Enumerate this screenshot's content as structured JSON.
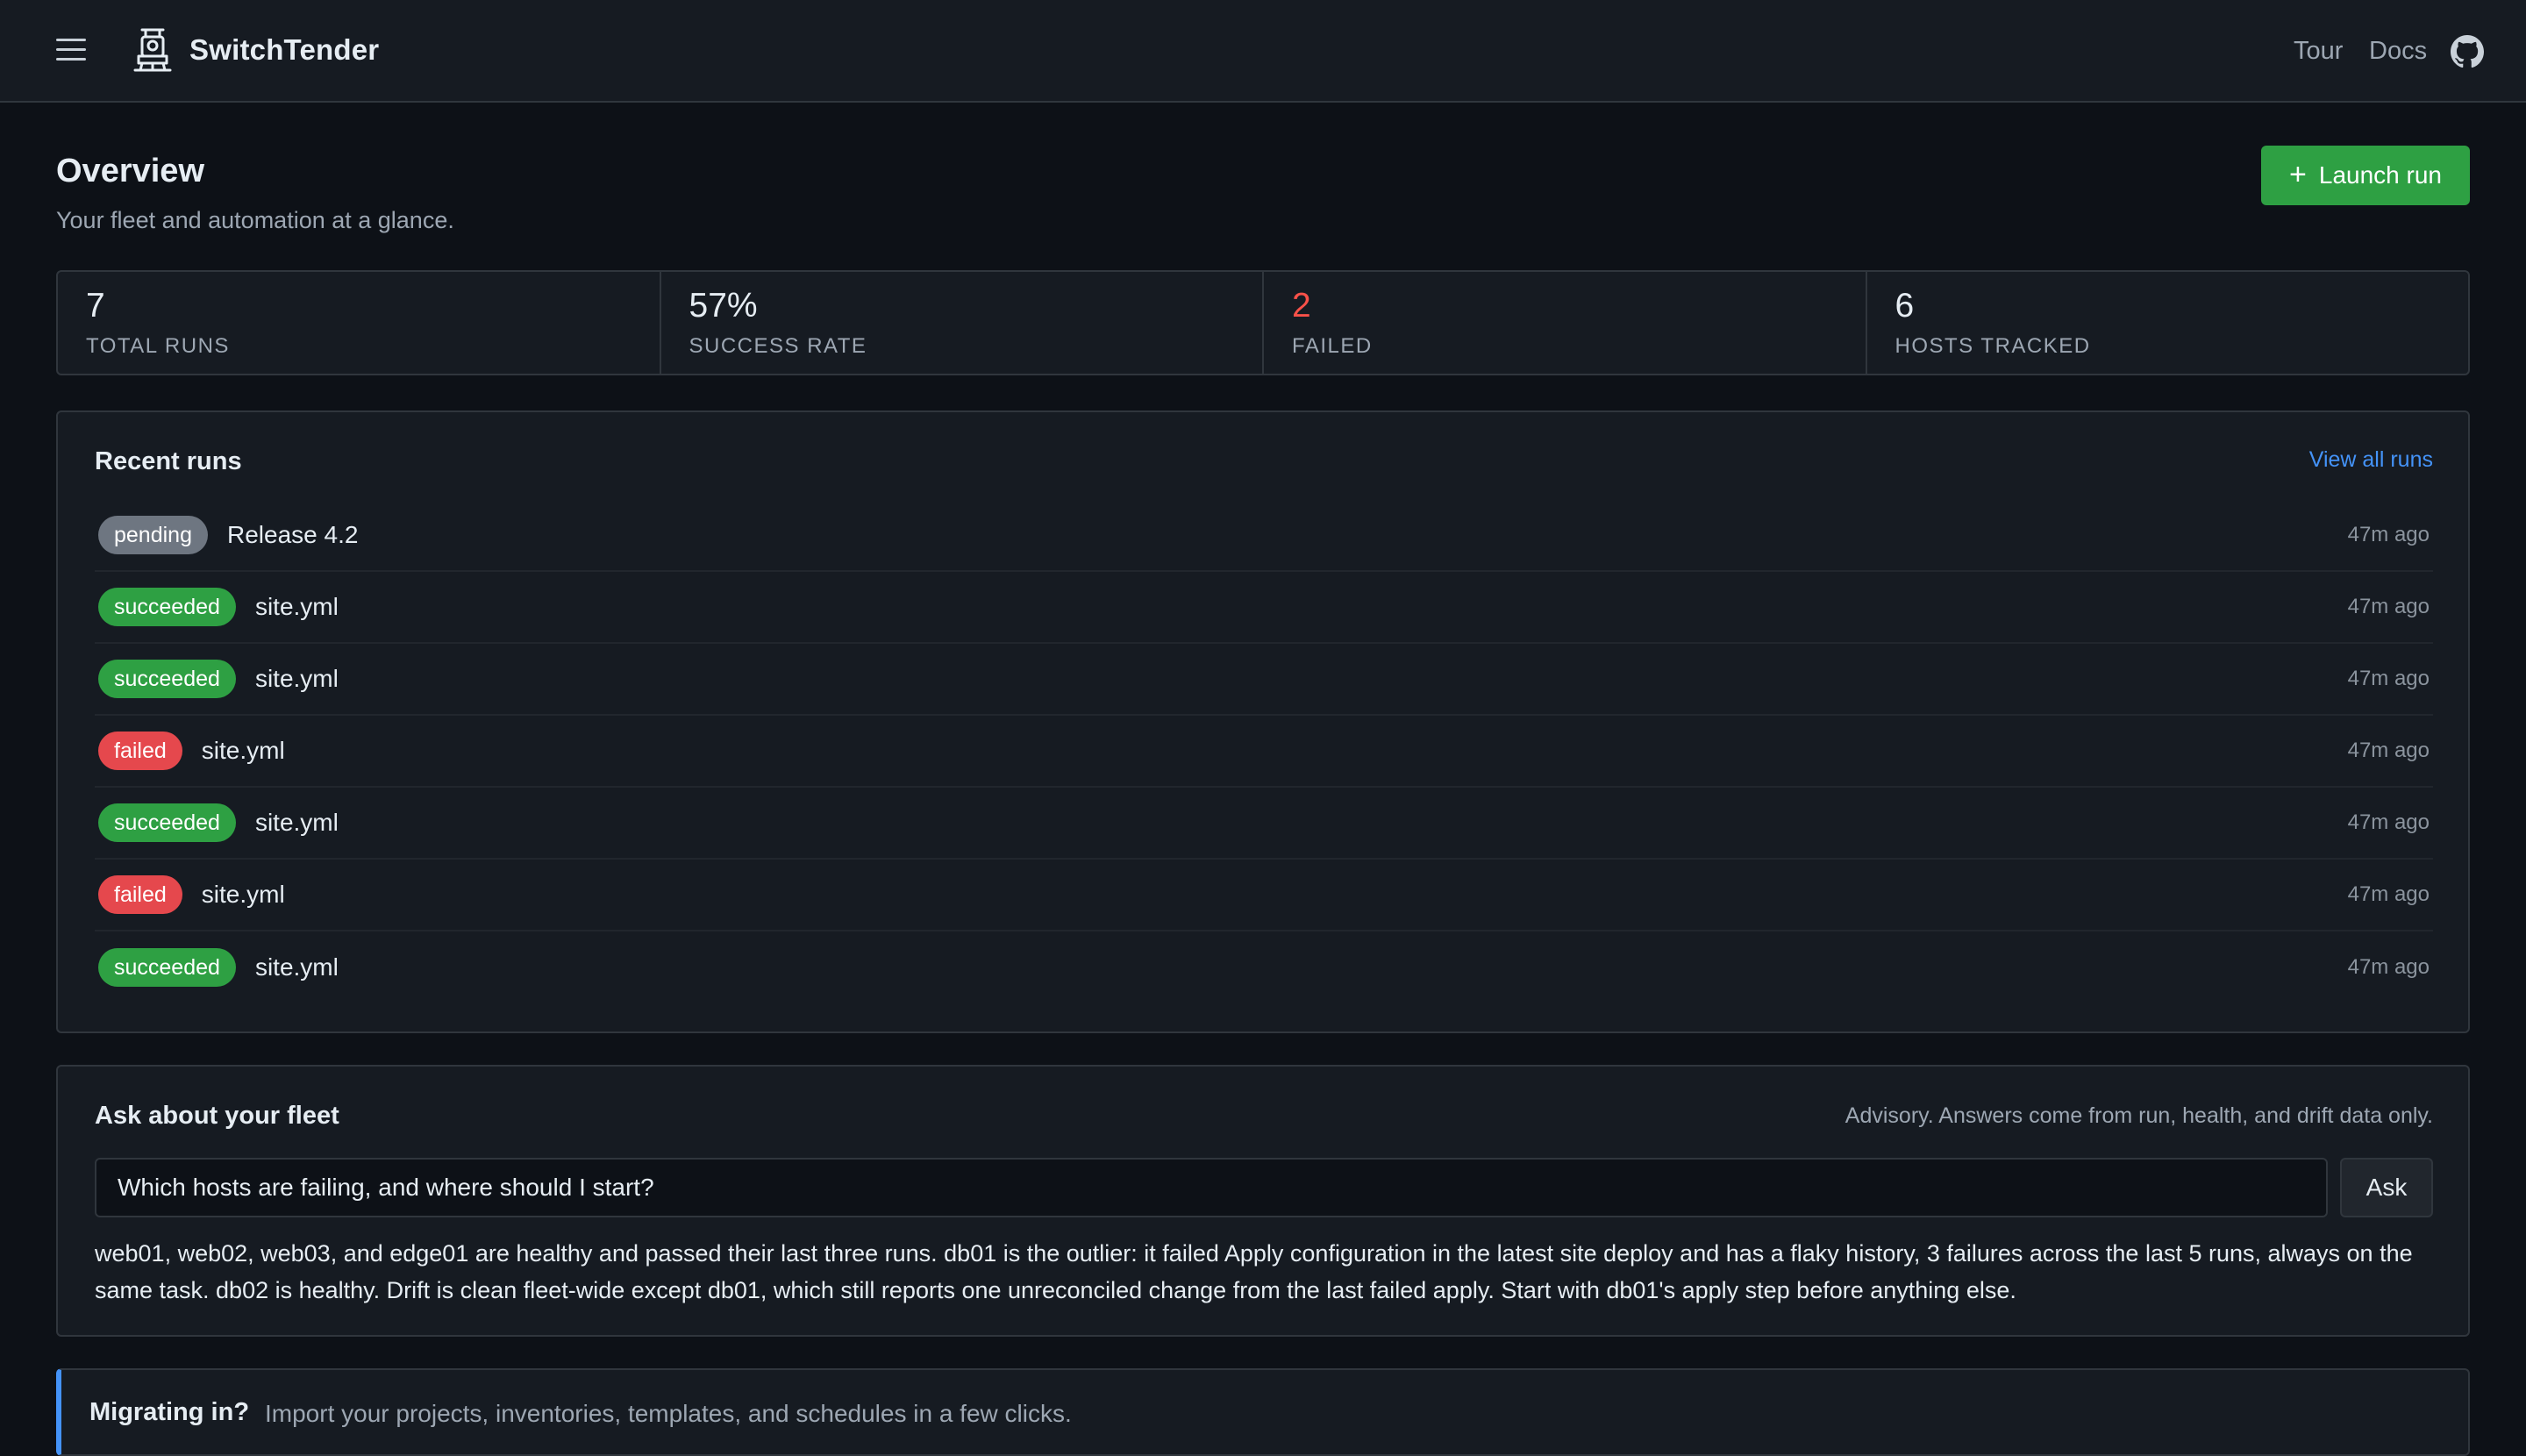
{
  "header": {
    "menu_icon": "hamburger-icon",
    "logo_icon": "locomotive-icon",
    "brand": "SwitchTender",
    "nav": {
      "tour": "Tour",
      "docs": "Docs"
    },
    "github_icon": "github-icon"
  },
  "page": {
    "title": "Overview",
    "subtitle": "Your fleet and automation at a glance.",
    "launch_label": "Launch run"
  },
  "stats": [
    {
      "value": "7",
      "label": "TOTAL RUNS"
    },
    {
      "value": "57%",
      "label": "SUCCESS RATE"
    },
    {
      "value": "2",
      "label": "FAILED"
    },
    {
      "value": "6",
      "label": "HOSTS TRACKED"
    }
  ],
  "recent_runs": {
    "title": "Recent runs",
    "view_all": "View all runs",
    "rows": [
      {
        "status": "pending",
        "name": "Release 4.2",
        "time": "47m ago"
      },
      {
        "status": "succeeded",
        "name": "site.yml",
        "time": "47m ago"
      },
      {
        "status": "succeeded",
        "name": "site.yml",
        "time": "47m ago"
      },
      {
        "status": "failed",
        "name": "site.yml",
        "time": "47m ago"
      },
      {
        "status": "succeeded",
        "name": "site.yml",
        "time": "47m ago"
      },
      {
        "status": "failed",
        "name": "site.yml",
        "time": "47m ago"
      },
      {
        "status": "succeeded",
        "name": "site.yml",
        "time": "47m ago"
      }
    ]
  },
  "ask": {
    "title": "Ask about your fleet",
    "advisory": "Advisory. Answers come from run, health, and drift data only.",
    "input_value": "Which hosts are failing, and where should I start?",
    "button": "Ask",
    "answer": "web01, web02, web03, and edge01 are healthy and passed their last three runs. db01 is the outlier: it failed Apply configuration in the latest site deploy and has a flaky history, 3 failures across the last 5 runs, always on the same task. db02 is healthy. Drift is clean fleet-wide except db01, which still reports one unreconciled change from the last failed apply. Start with db01's apply step before anything else."
  },
  "migrate": {
    "title": "Migrating in?",
    "text": "Import your projects, inventories, templates, and schedules in a few clicks."
  },
  "colors": {
    "background": "#0d1117",
    "surface": "#161b22",
    "border": "#30363d",
    "success": "#2ea043",
    "danger": "#e5484d",
    "pending": "#6e7681",
    "link": "#4493f8"
  }
}
